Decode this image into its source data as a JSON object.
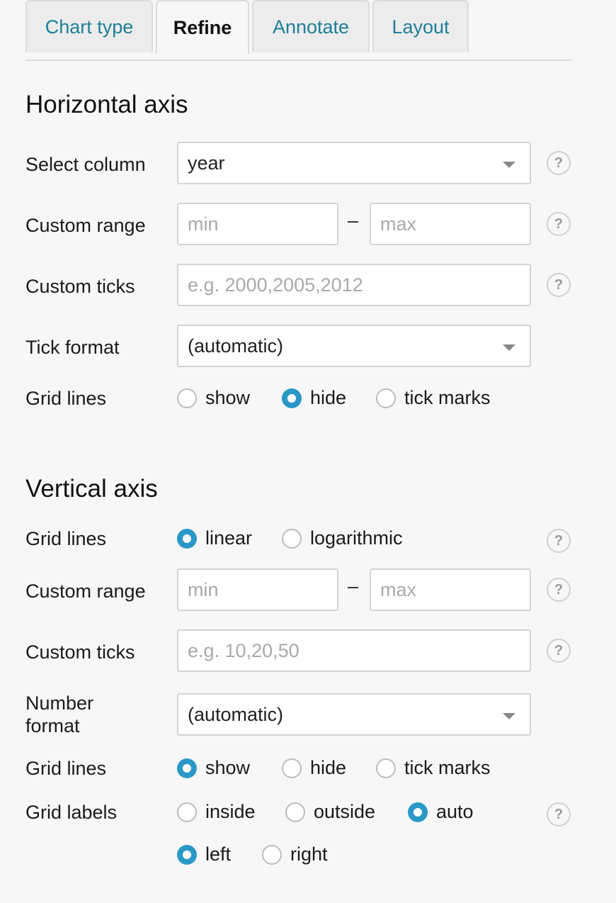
{
  "tabs": [
    {
      "label": "Chart type",
      "active": false
    },
    {
      "label": "Refine",
      "active": true
    },
    {
      "label": "Annotate",
      "active": false
    },
    {
      "label": "Layout",
      "active": false
    }
  ],
  "horizontal": {
    "title": "Horizontal axis",
    "select_column": {
      "label": "Select column",
      "value": "year"
    },
    "custom_range": {
      "label": "Custom range",
      "min_placeholder": "min",
      "separator": "–",
      "max_placeholder": "max"
    },
    "custom_ticks": {
      "label": "Custom ticks",
      "placeholder": "e.g. 2000,2005,2012"
    },
    "tick_format": {
      "label": "Tick format",
      "value": "(automatic)"
    },
    "grid_lines": {
      "label": "Grid lines",
      "options": [
        "show",
        "hide",
        "tick marks"
      ],
      "selected": "hide"
    }
  },
  "vertical": {
    "title": "Vertical axis",
    "scale": {
      "label": "Grid lines",
      "options": [
        "linear",
        "logarithmic"
      ],
      "selected": "linear"
    },
    "custom_range": {
      "label": "Custom range",
      "min_placeholder": "min",
      "separator": "–",
      "max_placeholder": "max"
    },
    "custom_ticks": {
      "label": "Custom ticks",
      "placeholder": "e.g. 10,20,50"
    },
    "number_format": {
      "label_line1": "Number",
      "label_line2": "format",
      "value": "(automatic)"
    },
    "grid_lines": {
      "label": "Grid lines",
      "options": [
        "show",
        "hide",
        "tick marks"
      ],
      "selected": "show"
    },
    "grid_labels": {
      "label": "Grid labels",
      "position_options": [
        "inside",
        "outside",
        "auto"
      ],
      "position_selected": "auto",
      "side_options": [
        "left",
        "right"
      ],
      "side_selected": "left"
    }
  },
  "help_glyph": "?",
  "colors": {
    "accent": "#2a98c7",
    "tab_text": "#1d7f98",
    "background": "#f7f7f7"
  }
}
